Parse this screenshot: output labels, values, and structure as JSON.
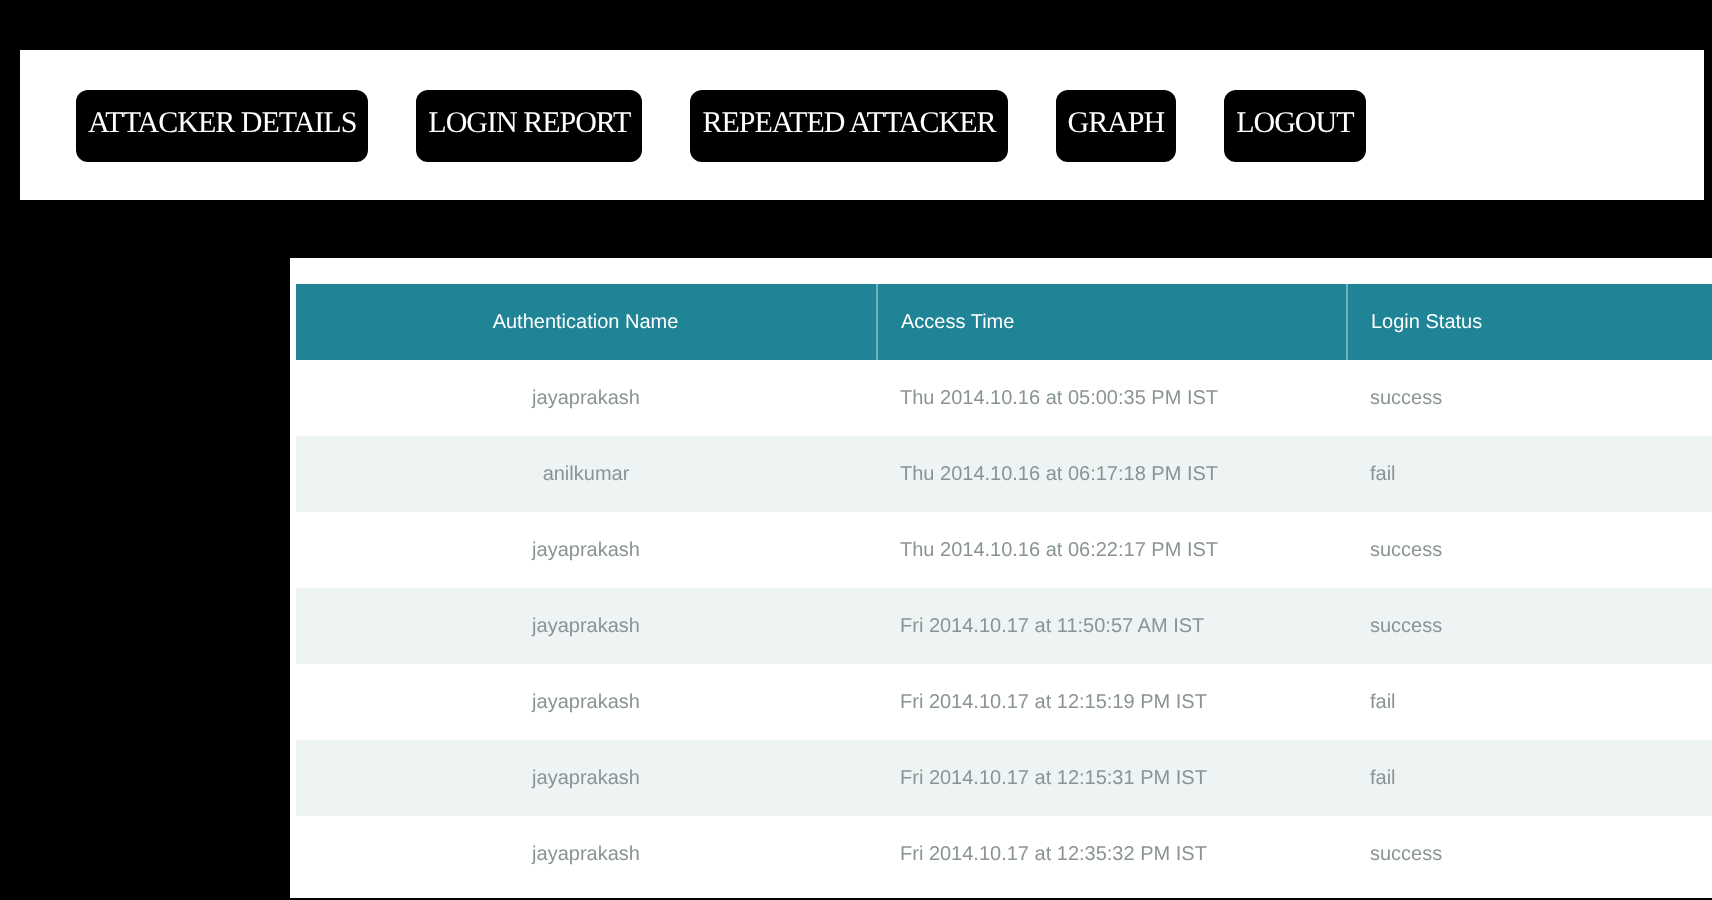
{
  "nav": {
    "buttons": [
      "ATTACKER DETAILS",
      "LOGIN REPORT",
      "REPEATED ATTACKER",
      "GRAPH",
      "LOGOUT"
    ]
  },
  "table": {
    "columns": [
      "Authentication Name",
      "Access Time",
      "Login Status"
    ],
    "rows": [
      [
        "jayaprakash",
        "Thu 2014.10.16 at 05:00:35 PM IST",
        "success"
      ],
      [
        "anilkumar",
        "Thu 2014.10.16 at 06:17:18 PM IST",
        "fail"
      ],
      [
        "jayaprakash",
        "Thu 2014.10.16 at 06:22:17 PM IST",
        "success"
      ],
      [
        "jayaprakash",
        "Fri 2014.10.17 at 11:50:57 AM IST",
        "success"
      ],
      [
        "jayaprakash",
        "Fri 2014.10.17 at 12:15:19 PM IST",
        "fail"
      ],
      [
        "jayaprakash",
        "Fri 2014.10.17 at 12:15:31 PM IST",
        "fail"
      ],
      [
        "jayaprakash",
        "Fri 2014.10.17 at 12:35:32 PM IST",
        "success"
      ]
    ]
  }
}
